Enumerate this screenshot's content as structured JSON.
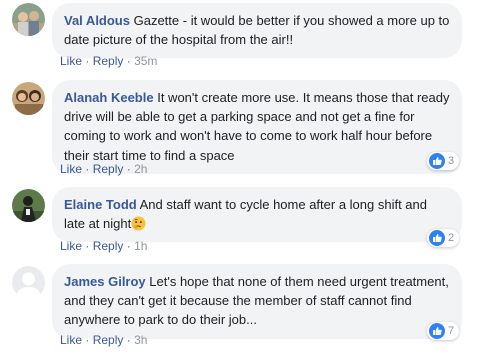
{
  "comments": [
    {
      "author": "Val Aldous",
      "text": "Gazette - it would be better if you showed a more up to date picture of the hospital from the air!!",
      "like_label": "Like",
      "reply_label": "Reply",
      "time": "35m",
      "reactions": null
    },
    {
      "author": "Alanah Keeble",
      "text": "It won't create more use. It means those that ready drive will be able to get a parking space and not get a fine for coming to work and won't have to come to work half hour before their start time to find a space",
      "like_label": "Like",
      "reply_label": "Reply",
      "time": "2h",
      "reactions": "3"
    },
    {
      "author": "Elaine Todd",
      "text": "And staff want to cycle home after a long shift and late at night",
      "emoji": "thinking-face",
      "like_label": "Like",
      "reply_label": "Reply",
      "time": "1h",
      "reactions": "2"
    },
    {
      "author": "James Gilroy",
      "text": "Let's hope that none of them need urgent treatment, and they can't get it because the member of staff cannot find anywhere to park to do their job...",
      "like_label": "Like",
      "reply_label": "Reply",
      "time": "3h",
      "reactions": "7"
    }
  ],
  "separator": "·",
  "colors": {
    "name": "#385898",
    "bubble": "#f2f3f5",
    "like_badge": "#2e81f4",
    "meta": "#90949c"
  }
}
